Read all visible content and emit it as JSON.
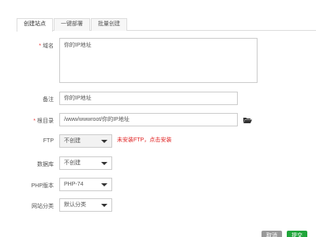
{
  "tabs": [
    {
      "label": "创建站点",
      "active": true
    },
    {
      "label": "一键部署",
      "active": false
    },
    {
      "label": "批量创建",
      "active": false
    }
  ],
  "domain": {
    "label": "域名",
    "placeholder": "你的IP地址"
  },
  "remark": {
    "label": "备注",
    "value": "你的IP地址"
  },
  "root_dir": {
    "label": "根目录",
    "value": "/www/wwwroot/你的IP地址"
  },
  "ftp": {
    "label": "FTP",
    "selected": "不创建",
    "warning": "未安装FTP，点击安装"
  },
  "database": {
    "label": "数据库",
    "selected": "不创建"
  },
  "php": {
    "label": "PHP版本",
    "selected": "PHP-74"
  },
  "category": {
    "label": "网站分类",
    "selected": "默认分类"
  },
  "buttons": {
    "close": "取消",
    "submit": "提交"
  },
  "colors": {
    "required": "#ee3333",
    "warning": "#e02020",
    "submit": "#20a53a"
  }
}
